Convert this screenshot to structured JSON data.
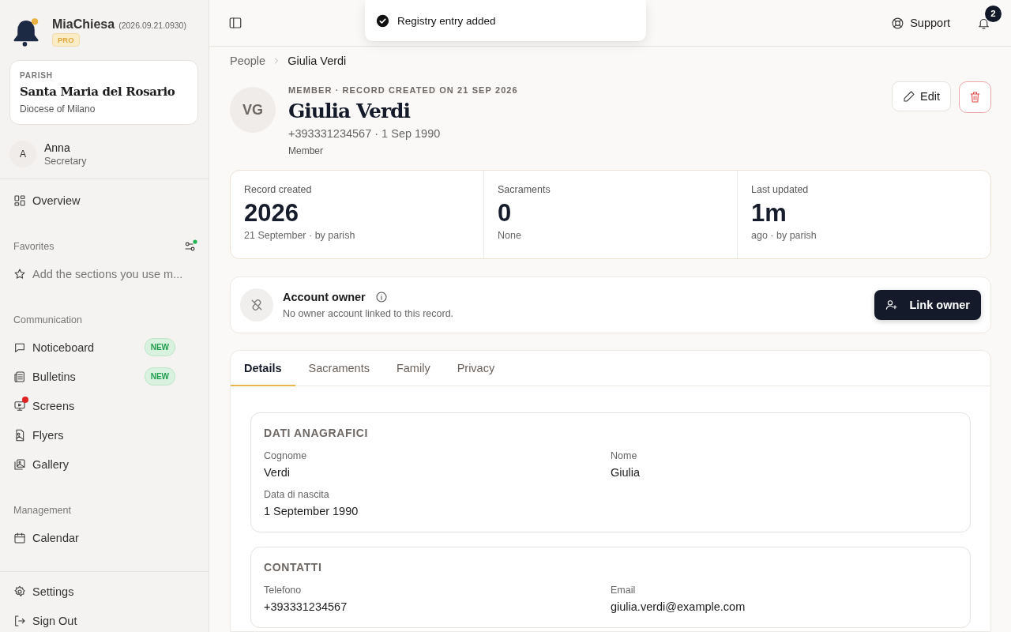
{
  "app": {
    "name": "MiaChiesa",
    "version": "(2026.09.21.0930)",
    "plan": "PRO"
  },
  "parish": {
    "label": "PARISH",
    "name": "Santa Maria del Rosario",
    "diocese": "Diocese of Milano"
  },
  "user": {
    "initial": "A",
    "name": "Anna",
    "role": "Secretary"
  },
  "nav": [
    {
      "kind": "plain",
      "items": [
        {
          "label": "Overview",
          "kind": "grid",
          "alert": false
        }
      ]
    },
    {
      "kind": "favorites",
      "title": "Favorites",
      "placeholder": "Add the sections you use m..."
    },
    {
      "kind": "plain",
      "title": "Communication",
      "items": [
        {
          "label": "Noticeboard",
          "kind": "chat",
          "badge": "NEW",
          "alert": false
        },
        {
          "label": "Bulletins",
          "kind": "news",
          "badge": "NEW",
          "alert": false
        },
        {
          "label": "Screens",
          "kind": "screen",
          "alert": true
        },
        {
          "label": "Flyers",
          "kind": "file",
          "alert": false
        },
        {
          "label": "Gallery",
          "kind": "gallery",
          "alert": false
        }
      ]
    },
    {
      "kind": "plain",
      "title": "Management",
      "items": [
        {
          "label": "Calendar",
          "kind": "calendar",
          "alert": false
        }
      ]
    }
  ],
  "footer_nav": [
    {
      "label": "Settings",
      "kind": "gear"
    },
    {
      "label": "Sign Out",
      "kind": "signout"
    }
  ],
  "toast": {
    "text": "Registry entry added"
  },
  "header": {
    "support": "Support",
    "notifications": "2"
  },
  "breadcrumb": [
    "People",
    "Giulia Verdi"
  ],
  "profile": {
    "initials": "VG",
    "eyebrow": "MEMBER · RECORD CREATED ON 21 SEP 2026",
    "name": "Giulia Verdi",
    "subtitle": "+393331234567 · 1 Sep 1990",
    "role": "Member",
    "edit": "Edit"
  },
  "stats": [
    {
      "label": "Record created",
      "value": "2026",
      "note": "21 September · by parish"
    },
    {
      "label": "Sacraments",
      "value": "0",
      "note": "None"
    },
    {
      "label": "Last updated",
      "value": "1m",
      "note": "ago · by parish"
    }
  ],
  "owner": {
    "title": "Account owner",
    "text": "No owner account linked to this record.",
    "button": "Link owner"
  },
  "tabs": [
    {
      "label": "Details",
      "selected": true
    },
    {
      "label": "Sacraments",
      "selected": false
    },
    {
      "label": "Family",
      "selected": false
    },
    {
      "label": "Privacy",
      "selected": false
    }
  ],
  "sections": [
    {
      "title": "DATI ANAGRAFICI",
      "fields": [
        {
          "label": "Cognome",
          "value": "Verdi"
        },
        {
          "label": "Nome",
          "value": "Giulia"
        },
        {
          "label": "Data di nascita",
          "value": "1 September 1990"
        }
      ]
    },
    {
      "title": "CONTATTI",
      "fields": [
        {
          "label": "Telefono",
          "value": "+393331234567"
        },
        {
          "label": "Email",
          "value": "giulia.verdi@example.com"
        }
      ]
    }
  ]
}
